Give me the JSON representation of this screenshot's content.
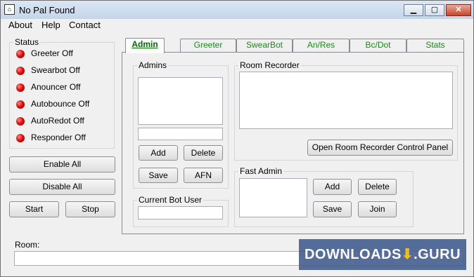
{
  "window": {
    "title": "No Pal Found",
    "app_icon": "palace-app-icon",
    "controls": [
      "minimize-icon",
      "maximize-icon",
      "close-icon"
    ]
  },
  "menu": {
    "items": [
      "About",
      "Help",
      "Contact"
    ]
  },
  "status": {
    "label": "Status",
    "items": [
      "Greeter Off",
      "Swearbot Off",
      "Anouncer Off",
      "Autobounce Off",
      "AutoRedot Off",
      "Responder Off"
    ],
    "led_color": "#e01010"
  },
  "left_buttons": {
    "enable_all": "Enable All",
    "disable_all": "Disable All",
    "start": "Start",
    "stop": "Stop"
  },
  "tabs": [
    "Admin",
    "Greeter",
    "SwearBot",
    "An/Res",
    "Bc/Dot",
    "Stats"
  ],
  "active_tab": "Admin",
  "admin_panel": {
    "admins_label": "Admins",
    "admins_input_value": "",
    "add": "Add",
    "delete": "Delete",
    "save": "Save",
    "afn": "AFN",
    "current_bot_user_label": "Current Bot User",
    "current_bot_user_value": "",
    "room_recorder_label": "Room Recorder",
    "open_recorder_button": "Open Room Recorder Control Panel",
    "fast_admin_label": "Fast Admin",
    "fast_add": "Add",
    "fast_delete": "Delete",
    "fast_save": "Save",
    "fast_join": "Join"
  },
  "room": {
    "label": "Room:",
    "value": ""
  },
  "watermark": {
    "text": "DOWNLOADS",
    "suffix": ".GURU"
  }
}
